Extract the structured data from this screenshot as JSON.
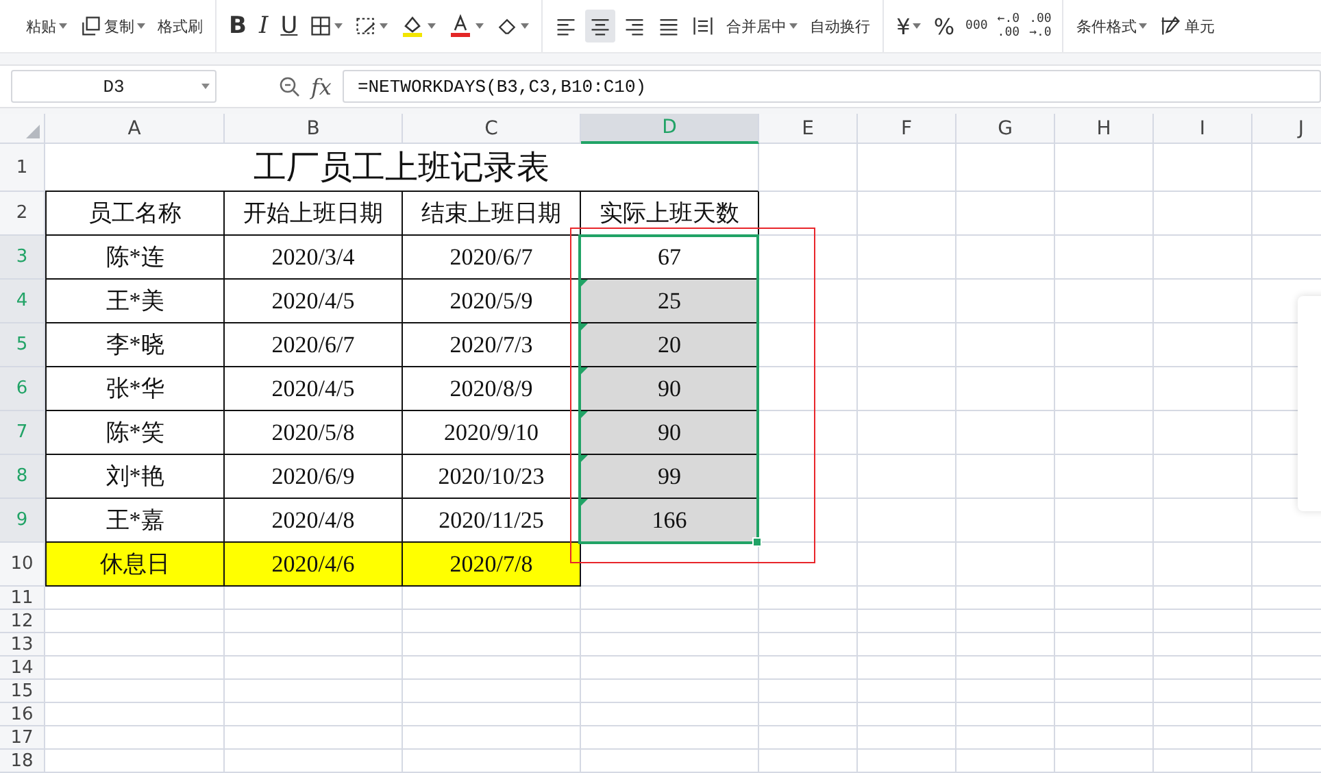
{
  "toolbar": {
    "paste": "粘贴",
    "copy": "复制",
    "format_painter": "格式刷",
    "bold": "B",
    "italic": "I",
    "underline": "U",
    "align": [
      {
        "selected": false
      },
      {
        "selected": true
      },
      {
        "selected": false
      },
      {
        "selected": false
      },
      {
        "selected": false
      }
    ],
    "merge_center": "合并居中",
    "wrap_text": "自动换行",
    "currency": "¥",
    "percent": "%",
    "thousands": "000",
    "increase_decimal": [
      "←.0",
      ".00"
    ],
    "decrease_decimal": [
      ".00",
      "→.0"
    ],
    "conditional_format": "条件格式",
    "cell_style": "单元"
  },
  "formula_bar": {
    "name_box": "D3",
    "function_label": "fx",
    "formula": "=NETWORKDAYS(B3,C3,B10:C10)"
  },
  "sheet": {
    "columns": [
      {
        "label": "A",
        "selected": false
      },
      {
        "label": "B",
        "selected": false
      },
      {
        "label": "C",
        "selected": false
      },
      {
        "label": "D",
        "selected": true
      },
      {
        "label": "E",
        "selected": false
      },
      {
        "label": "F",
        "selected": false
      },
      {
        "label": "G",
        "selected": false
      },
      {
        "label": "H",
        "selected": false
      },
      {
        "label": "I",
        "selected": false
      },
      {
        "label": "J",
        "selected": false
      }
    ],
    "row_numbers": [
      {
        "label": "1",
        "selected": false
      },
      {
        "label": "2",
        "selected": false
      },
      {
        "label": "3",
        "selected": true
      },
      {
        "label": "4",
        "selected": true
      },
      {
        "label": "5",
        "selected": true
      },
      {
        "label": "6",
        "selected": true
      },
      {
        "label": "7",
        "selected": true
      },
      {
        "label": "8",
        "selected": true
      },
      {
        "label": "9",
        "selected": true
      },
      {
        "label": "10",
        "selected": false
      },
      {
        "label": "11",
        "selected": false
      },
      {
        "label": "12",
        "selected": false
      },
      {
        "label": "13",
        "selected": false
      },
      {
        "label": "14",
        "selected": false
      },
      {
        "label": "15",
        "selected": false
      },
      {
        "label": "16",
        "selected": false
      },
      {
        "label": "17",
        "selected": false
      },
      {
        "label": "18",
        "selected": false
      }
    ],
    "title": "工厂员工上班记录表",
    "headers": [
      "员工名称",
      "开始上班日期",
      "结束上班日期",
      "实际上班天数"
    ],
    "rows": [
      {
        "name": "陈*连",
        "start": "2020/3/4",
        "end": "2020/6/7",
        "days": "67",
        "selected": true,
        "active": true,
        "warning": false
      },
      {
        "name": "王*美",
        "start": "2020/4/5",
        "end": "2020/5/9",
        "days": "25",
        "selected": true,
        "active": false,
        "warning": true
      },
      {
        "name": "李*晓",
        "start": "2020/6/7",
        "end": "2020/7/3",
        "days": "20",
        "selected": true,
        "active": false,
        "warning": true
      },
      {
        "name": "张*华",
        "start": "2020/4/5",
        "end": "2020/8/9",
        "days": "90",
        "selected": true,
        "active": false,
        "warning": true
      },
      {
        "name": "陈*笑",
        "start": "2020/5/8",
        "end": "2020/9/10",
        "days": "90",
        "selected": true,
        "active": false,
        "warning": true
      },
      {
        "name": "刘*艳",
        "start": "2020/6/9",
        "end": "2020/10/23",
        "days": "99",
        "selected": true,
        "active": false,
        "warning": true
      },
      {
        "name": "王*嘉",
        "start": "2020/4/8",
        "end": "2020/11/25",
        "days": "166",
        "selected": true,
        "active": false,
        "warning": true
      }
    ],
    "holiday": {
      "label": "休息日",
      "start": "2020/4/6",
      "end": "2020/7/8",
      "highlighted": true
    }
  }
}
